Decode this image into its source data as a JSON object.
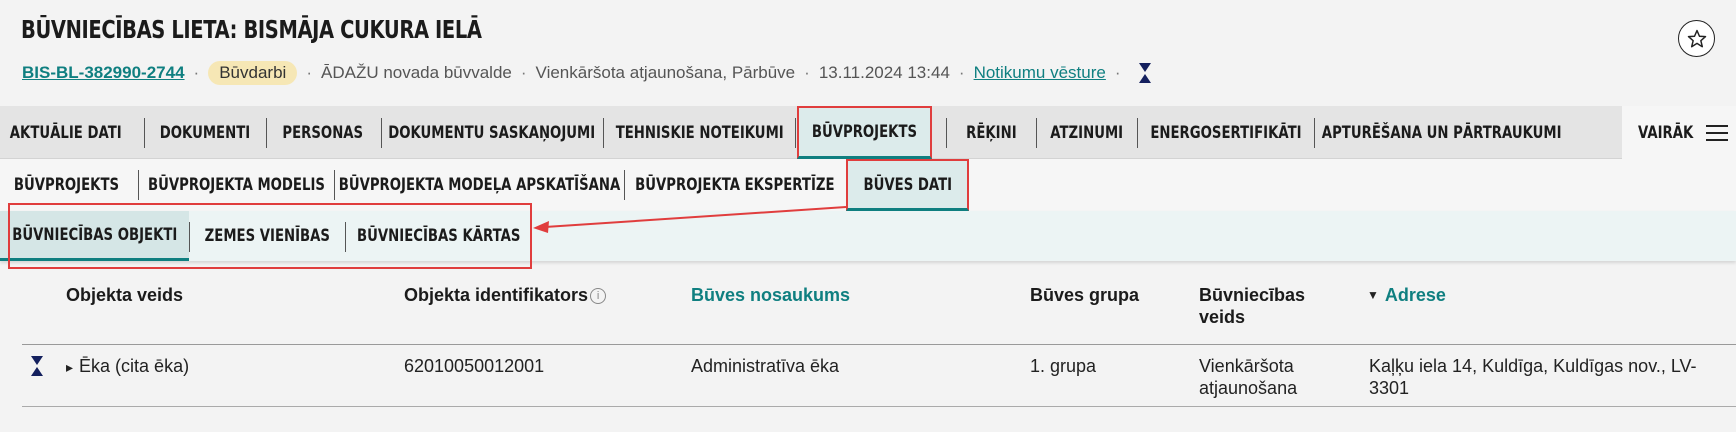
{
  "header": {
    "title": "Būvniecības lieta: Bismāja cukura ielā",
    "case_id": "BIS-BL-382990-2744",
    "status_badge": "Būvdarbi",
    "authority": "ĀDAŽU novada būvvalde",
    "procedure": "Vienkāršota atjaunošana, Pārbūve",
    "datetime": "13.11.2024 13:44",
    "history_link": "Notikumu vēsture",
    "separator": "·"
  },
  "tabs_primary": [
    {
      "label": "Aktuālie dati"
    },
    {
      "label": "Dokumenti"
    },
    {
      "label": "Personas"
    },
    {
      "label": "Dokumentu saskaņojumi"
    },
    {
      "label": "Tehniskie noteikumi"
    },
    {
      "label": "Būvprojekts",
      "active": true
    },
    {
      "label": "Rēķini"
    },
    {
      "label": "Atzinumi"
    },
    {
      "label": "Energosertifikāti"
    },
    {
      "label": "Apturēšana un pārtraukumi"
    }
  ],
  "more_label": "Vairāk",
  "tabs_secondary": [
    {
      "label": "Būvprojekts"
    },
    {
      "label": "Būvprojekta modelis"
    },
    {
      "label": "Būvprojekta modeļa apskatīšana"
    },
    {
      "label": "Būvprojekta ekspertīze"
    },
    {
      "label": "Būves dati",
      "active": true
    }
  ],
  "tabs_tertiary": [
    {
      "label": "Būvniecības objekti",
      "active": true
    },
    {
      "label": "Zemes vienības"
    },
    {
      "label": "Būvniecības kārtas"
    }
  ],
  "table": {
    "columns": [
      {
        "label": "Objekta veids"
      },
      {
        "label": "Objekta identifikators"
      },
      {
        "label": "Būves nosaukums"
      },
      {
        "label": "Būves grupa"
      },
      {
        "label": "Būvniecības veids"
      },
      {
        "label": "Adrese",
        "sort_icon": "▼"
      }
    ],
    "rows": [
      {
        "expand_icon": "▸",
        "object_type": "Ēka (cita ēka)",
        "identifier": "62010050012001",
        "name": "Administratīva ēka",
        "group": "1. grupa",
        "construction_type": "Vienkāršota atjaunošana",
        "address": "Kaļķu iela 14, Kuldīga, Kuldīgas nov., LV-3301"
      }
    ]
  },
  "colors": {
    "accent": "#0f7f80",
    "annotation": "#e03d3d",
    "badge": "#f6e7b5",
    "hourglass": "#14205e"
  },
  "icons": {
    "favorite": "star-icon",
    "status": "hourglass-icon",
    "menu": "hamburger-icon",
    "info": "info-icon"
  },
  "info_glyph": "i"
}
